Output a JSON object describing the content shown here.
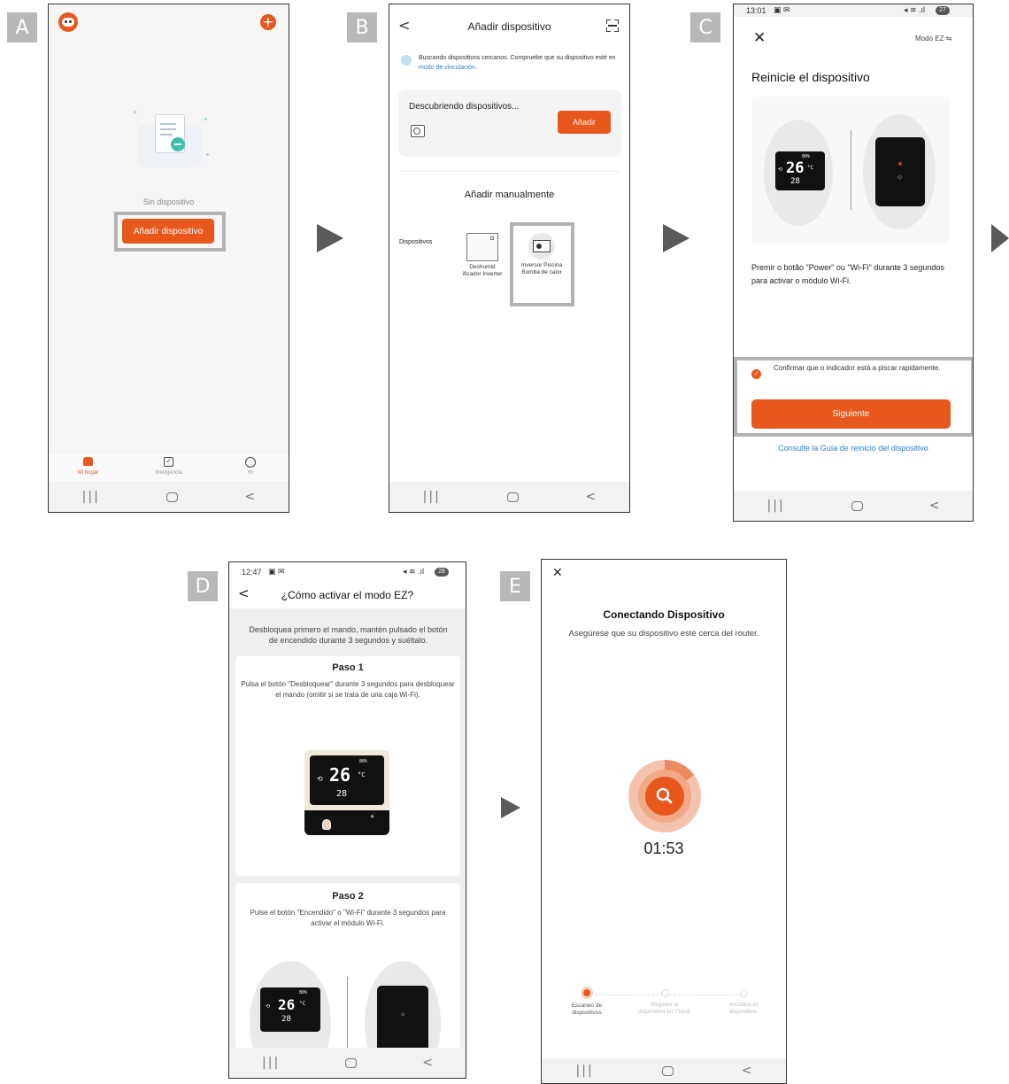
{
  "steps": {
    "a": "A",
    "b": "B",
    "c": "C",
    "d": "D",
    "e": "E"
  },
  "screenA": {
    "empty_text": "Sin dispositivo",
    "add_device_button": "Añadir dispositivo",
    "tabs": [
      {
        "label": "Mi hogar",
        "icon": "home-icon"
      },
      {
        "label": "Inteligencia",
        "icon": "check-square-icon"
      },
      {
        "label": "Yo",
        "icon": "user-circle-icon"
      }
    ],
    "colors": {
      "accent": "#e8571b"
    }
  },
  "screenB": {
    "title": "Añadir dispositivo",
    "searching_text": "Buscando dispositivos cercanos. Compruebe que su dispositivo esté en",
    "pairing_link": "modo de vinculación",
    "discovering_title": "Descubriendo dispositivos...",
    "add_button": "Añadir",
    "manual_title": "Añadir manualmente",
    "category_label": "Dispositivos",
    "devices": [
      {
        "name": "Deshumid ificador Inverter",
        "icon": "dehumidifier-icon"
      },
      {
        "name": "Inversor Piscina Bomba de calor",
        "icon": "heat-pump-icon"
      }
    ]
  },
  "screenC": {
    "status_time": "13:01",
    "mode_label": "Modo EZ",
    "title": "Reinicie el dispositivo",
    "display_big": "26",
    "display_small": "28",
    "display_unit": "°C",
    "display_top": "80%",
    "instructions": "Premir o botão \"Power\" ou \"Wi-Fi\" durante 3 segundos para activar o módulo Wi-Fi.",
    "confirm_text": "Confirmar que o indicador está a piscar rapidamente.",
    "next_button": "Siguiente",
    "guide_link": "Consulte la Guía de reinicio del dispositivo",
    "battery": "27"
  },
  "screenD": {
    "status_time": "12:47",
    "battery": "28",
    "title": "¿Cómo activar el modo EZ?",
    "intro": "Desbloquea primero el mando, mantén pulsado el botón de encendido durante 3 segundos y suéltalo.",
    "step1_title": "Paso 1",
    "step1_text": "Pulsa el botón \"Desbloquear\" durante 3 segundos para desbloquear el mando (omitir si se trata de una caja Wi-Fi).",
    "step2_title": "Paso 2",
    "step2_text": "Pulse el botón \"Encendido\" o \"Wi-Fi\" durante 3 segundos para activar el módulo Wi-Fi.",
    "display_big": "26",
    "display_small": "28",
    "display_unit": "°C",
    "display_top": "80%"
  },
  "screenE": {
    "title": "Conectando Dispositivo",
    "subtitle": "Asegúrese que su dispositivo esté cerca del router.",
    "timer": "01:53",
    "progress_fraction": 0.15,
    "steps": [
      {
        "label": "Escaneo de dispositivos",
        "active": true
      },
      {
        "label": "Registre el dispositivo en Cloud.",
        "active": false
      },
      {
        "label": "Inicialice el dispositivo.",
        "active": false
      }
    ]
  }
}
